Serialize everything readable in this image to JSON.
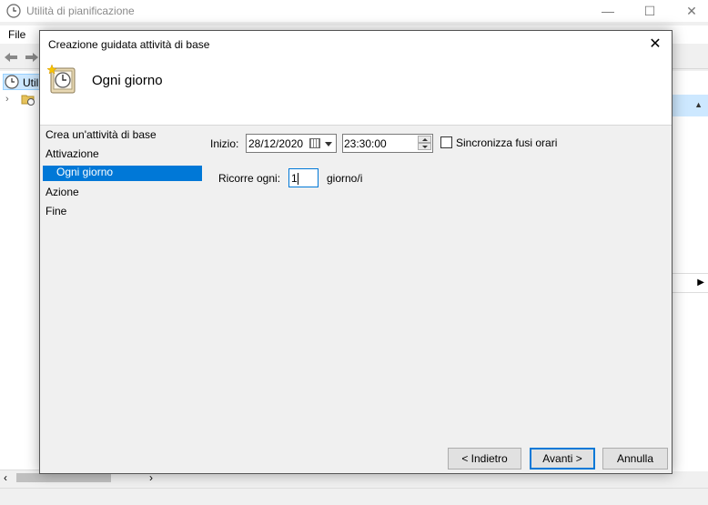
{
  "main_window": {
    "title": "Utilità di pianificazione",
    "menu": {
      "file": "File"
    },
    "tree_item": "Util"
  },
  "dialog": {
    "title": "Creazione guidata attività di base",
    "header_title": "Ogni giorno",
    "steps": [
      {
        "label": "Crea un'attività di base"
      },
      {
        "label": "Attivazione"
      },
      {
        "label": "Ogni giorno",
        "active": true
      },
      {
        "label": "Azione"
      },
      {
        "label": "Fine"
      }
    ],
    "form": {
      "start_label": "Inizio:",
      "date_value": "28/12/2020",
      "time_value": "23:30:00",
      "sync_timezones_label": "Sincronizza fusi orari",
      "sync_timezones_checked": false,
      "recur_label": "Ricorre ogni:",
      "recur_value": "1",
      "recur_unit": "giorno/i"
    },
    "buttons": {
      "back": "< Indietro",
      "next": "Avanti >",
      "cancel": "Annulla"
    }
  },
  "colors": {
    "accent": "#0078d7",
    "selection_bg": "#cde8ff"
  }
}
